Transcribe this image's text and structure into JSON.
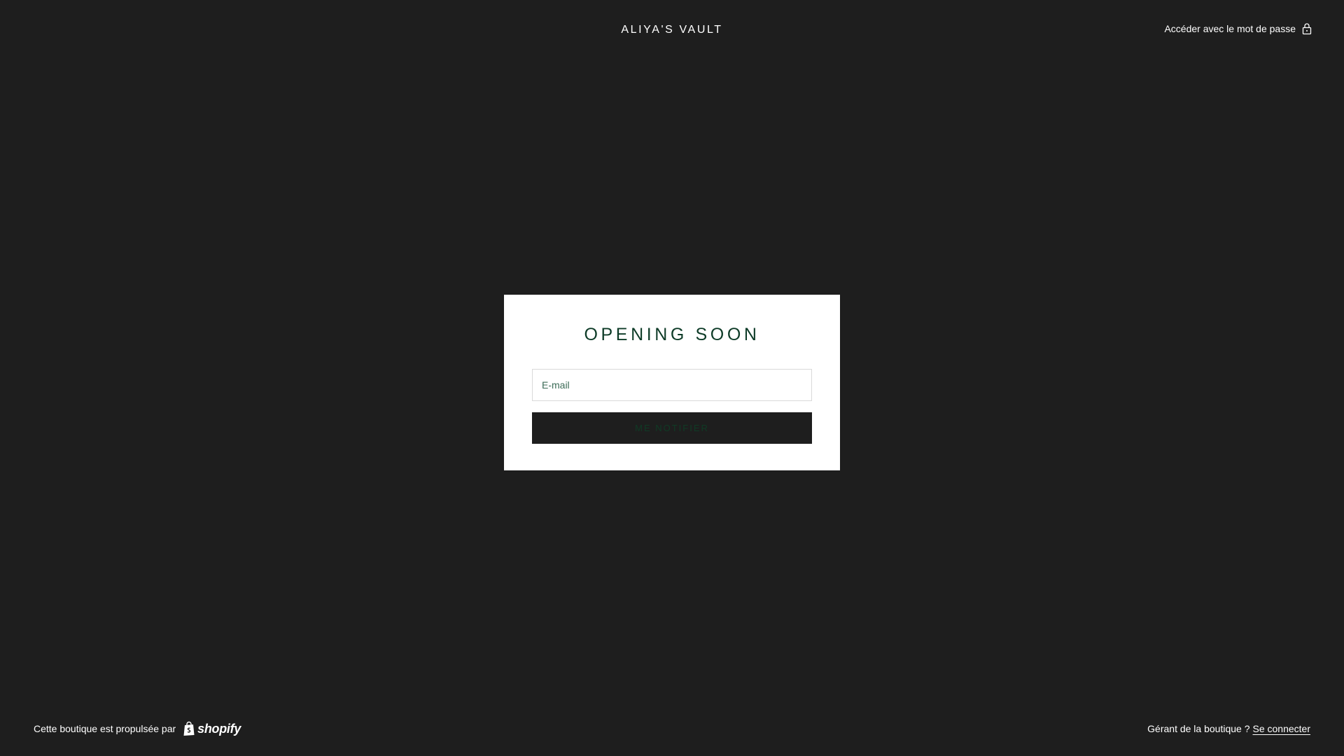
{
  "header": {
    "brand": "ALIYA'S VAULT",
    "password_link_label": "Accéder avec le mot de passe",
    "password_icon": "lock-icon"
  },
  "card": {
    "title": "OPENING SOON",
    "email_placeholder": "E-mail",
    "email_value": "",
    "notify_label": "ME NOTIFIER"
  },
  "footer": {
    "powered_by": "Cette boutique est propulsée par",
    "shopify_logo_text": "shopify",
    "shopify_icon": "shopify-bag-icon",
    "owner_question": "Gérant de la boutique ?",
    "login_label": "Se connecter"
  },
  "colors": {
    "background": "#1e1e1e",
    "card": "#ffffff",
    "title": "#0d3b27",
    "button": "#1e1e1e",
    "button_text": "#0f3b25"
  }
}
